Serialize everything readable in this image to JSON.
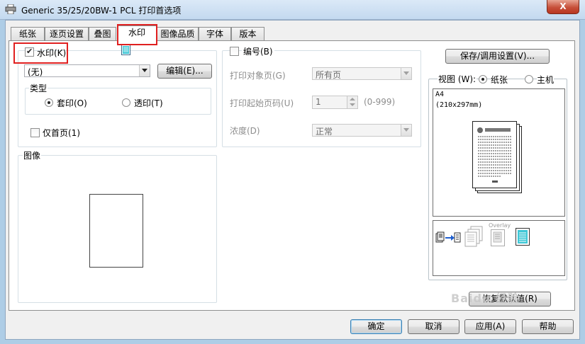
{
  "window": {
    "title": "Generic 35/25/20BW-1 PCL 打印首选项",
    "close_label": "X"
  },
  "tabs": [
    {
      "label": "纸张"
    },
    {
      "label": "逐页设置"
    },
    {
      "label": "叠图"
    },
    {
      "label": "水印",
      "active": true
    },
    {
      "label": "图像品质"
    },
    {
      "label": "字体"
    },
    {
      "label": "版本"
    }
  ],
  "watermark": {
    "enabled_label": "水印(K)",
    "enabled": true,
    "selected": "(无)",
    "edit_button": "编辑(E)...",
    "type_group_label": "类型",
    "type_options": [
      {
        "label": "套印(O)",
        "selected": true
      },
      {
        "label": "透印(T)",
        "selected": false
      }
    ],
    "first_page_only_label": "仅首页(1)",
    "first_page_only": false
  },
  "image_group": {
    "label": "图像"
  },
  "numbering": {
    "enabled_label": "编号(B)",
    "enabled": false,
    "target_pages_label": "打印对象页(G)",
    "target_pages_value": "所有页",
    "start_page_label": "打印起始页码(U)",
    "start_page_value": "1",
    "start_page_range": "(0-999)",
    "density_label": "浓度(D)",
    "density_value": "正常"
  },
  "right_panel": {
    "save_button": "保存/调用设置(V)...",
    "view_label": "视图 (W):",
    "view_options": [
      {
        "label": "纸张",
        "selected": true
      },
      {
        "label": "主机",
        "selected": false
      }
    ],
    "paper_size": "A4",
    "paper_dims": "(210x297mm)",
    "overlay_label": "Overlay",
    "restore_button": "恢复默认值(R)"
  },
  "footer": {
    "ok": "确定",
    "cancel": "取消",
    "apply": "应用(A)",
    "help": "帮助"
  },
  "watermark_overlay": "Baidu 经验",
  "colors": {
    "highlight": "#e02020",
    "accent": "#3c7fb1"
  }
}
